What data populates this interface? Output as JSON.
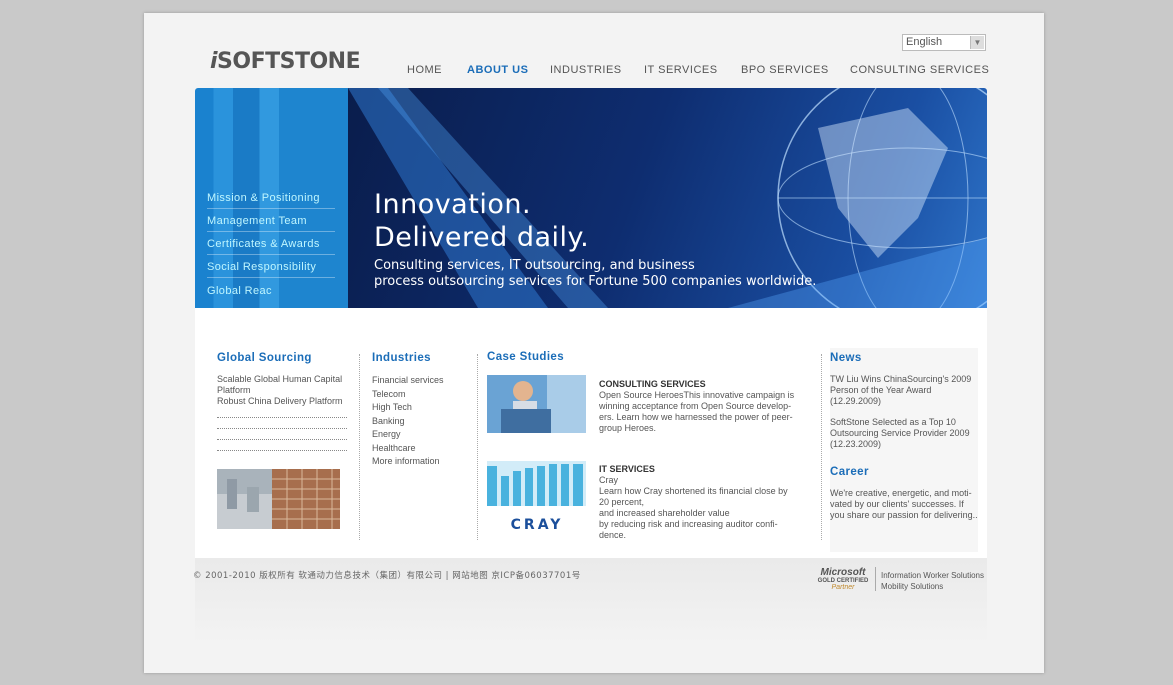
{
  "header": {
    "logo_prefix": "i",
    "logo_text": "SOFTSTONE",
    "language": "English"
  },
  "nav": {
    "home": "HOME",
    "about": "ABOUT US",
    "industries": "INDUSTRIES",
    "it_services": "IT SERVICES",
    "bpo_services": "BPO SERVICES",
    "consulting": "CONSULTING SERVICES"
  },
  "sidebar": {
    "items": [
      "Mission & Positioning",
      "Management Team",
      "Certificates & Awards",
      "Social Responsibility",
      "Global Reac"
    ]
  },
  "banner": {
    "headline_1": "Innovation.",
    "headline_2": "Delivered daily.",
    "sub_1": "Consulting services, IT outsourcing, and business",
    "sub_2": "process outsourcing services for Fortune 500 companies worldwide."
  },
  "global_sourcing": {
    "title": "Global Sourcing",
    "line_1": "Scalable Global Human Capital Platform",
    "line_2": "Robust China Delivery Platform"
  },
  "industries": {
    "title": "Industries",
    "items": [
      "Financial services",
      "Telecom",
      "High Tech",
      "Banking",
      "Energy",
      "Healthcare",
      "More information"
    ]
  },
  "case_studies": {
    "title": "Case Studies",
    "case_1_title": "CONSULTING SERVICES",
    "case_1_body": "Open Source HeroesThis innovative campaign is winning acceptance from Open Source develop-ers. Learn how we harnessed the power of peer-group Heroes.",
    "case_2_title": "IT SERVICES",
    "case_2_sub": "Cray",
    "case_2_body_1": "Learn how Cray shortened its financial close by 20 percent,",
    "case_2_body_2": "and increased shareholder value",
    "case_2_body_3": "by reducing risk and increasing auditor confi-dence.",
    "cray_logo": "CRAY"
  },
  "news": {
    "title": "News",
    "item_1": "TW Liu Wins ChinaSourcing's 2009 Person of the Year Award",
    "date_1": "(12.29.2009)",
    "item_2": "SoftStone Selected as a Top 10 Outsourcing Service Provider 2009",
    "date_2": "(12.23.2009)"
  },
  "career": {
    "title": "Career",
    "body": "We're creative, energetic, and moti-vated by our clients' successes. If you share our passion for delivering.."
  },
  "footer": {
    "copyright": "© 2001-2010 版权所有 软通动力信息技术（集团）有限公司 | 网站地图  京ICP备06037701号",
    "ms_1": "Microsoft",
    "ms_2": "GOLD CERTIFIED",
    "ms_3": "Partner",
    "ms_4": "Information Worker Solutions",
    "ms_5": "Mobility Solutions"
  }
}
